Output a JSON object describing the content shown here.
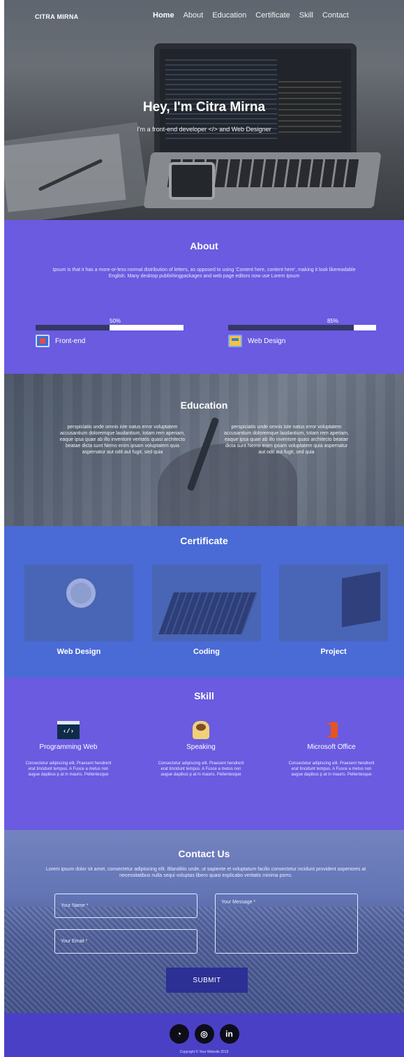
{
  "nav": {
    "brand": "CITRA MIRNA",
    "items": [
      "Home",
      "About",
      "Education",
      "Certificate",
      "Skill",
      "Contact"
    ],
    "active": "Home"
  },
  "hero": {
    "title": "Hey, I'm Citra Mirna",
    "subtitle": "I'm a front-end developer </> and Web Designer"
  },
  "about": {
    "title": "About",
    "text": "Ipsum is that it has a more-or-less normal distribution of letters, as opposed to using 'Content here, content here', making it look likereadable English. Many desktop publishingpackages and web page editors now use Lorem Ipsum",
    "skills": [
      {
        "label": "Front-end",
        "percent": 50,
        "percent_label": "50%",
        "icon": "front-end-icon"
      },
      {
        "label": "Web Design",
        "percent": 85,
        "percent_label": "85%",
        "icon": "web-design-icon"
      }
    ]
  },
  "education": {
    "title": "Education",
    "columns": [
      "perspiciatis unde omnis iste natus error voluptatem accusantium doloremque laudantium, totam rem aperiam, eaque ipsa quae ab illo inventore veritatis quasi architecto beatae dicta sunt Nemo enim ipsam voluptatem quia aspernatur aut odit aut fugit, sed quia",
      "perspiciatis unde omnis iste natus error voluptatem accusantium doloremque laudantium, totam rem aperiam, eaque ipsa quae ab illo inventore quasi architecto beatae dicta sunt Nemo enim ipsam voluptatem quia aspernatur aut odit aut fugit, sed quia"
    ]
  },
  "certificate": {
    "title": "Certificate",
    "cards": [
      "Web Design",
      "Coding",
      "Project"
    ]
  },
  "skill": {
    "title": "Skill",
    "items": [
      {
        "name": "Programming Web",
        "icon": "code-window-icon",
        "code_glyph": "‹/›",
        "desc": "Consectetur adipiscing elit. Praesent hendrerit erat tincidunt tempus. A Fusce a metus non augue dapibus p at in mauris. Pellentesque"
      },
      {
        "name": "Speaking",
        "icon": "speaker-person-icon",
        "desc": "Consectetur adipiscing elit. Praesent hendrerit erat tincidunt tempus. A Fusce a metus non augue dapibus p at in mauris. Pellentesque"
      },
      {
        "name": "Microsoft Office",
        "icon": "office-icon",
        "desc": "Consectetur adipiscing elit. Praesent hendrerit erat tincidunt tempus. A Fusce a metus non augue dapibus p at in mauris. Pellentesque"
      }
    ]
  },
  "contact": {
    "title": "Contact Us",
    "text": "Lorem ipsum dolor sit amet, consectetur adipisicing elit. Blanditiis unde, ut sapiente et voluptatum facilis consectetur incidunt provident asperiores at necessitatibus nulla sequi voluptas libero quasi explicabo veritatis minima porro.",
    "name_placeholder": "Your Name *",
    "email_placeholder": "Your Email *",
    "message_placeholder": "Your Message *",
    "submit_label": "SUBMIT"
  },
  "footer": {
    "socials": [
      {
        "icon": "github-icon",
        "glyph": "◔"
      },
      {
        "icon": "instagram-icon",
        "glyph": "◎"
      },
      {
        "icon": "linkedin-icon",
        "glyph": "in"
      }
    ],
    "copyright": "Copyright © Your Website 2019"
  },
  "colors": {
    "about_bg": "#6a5be0",
    "certificate_bg": "#4a6ad6",
    "footer_bg": "#4a40c6",
    "submit_bg": "#2c2f94",
    "skillbar_fill": "#343766"
  }
}
